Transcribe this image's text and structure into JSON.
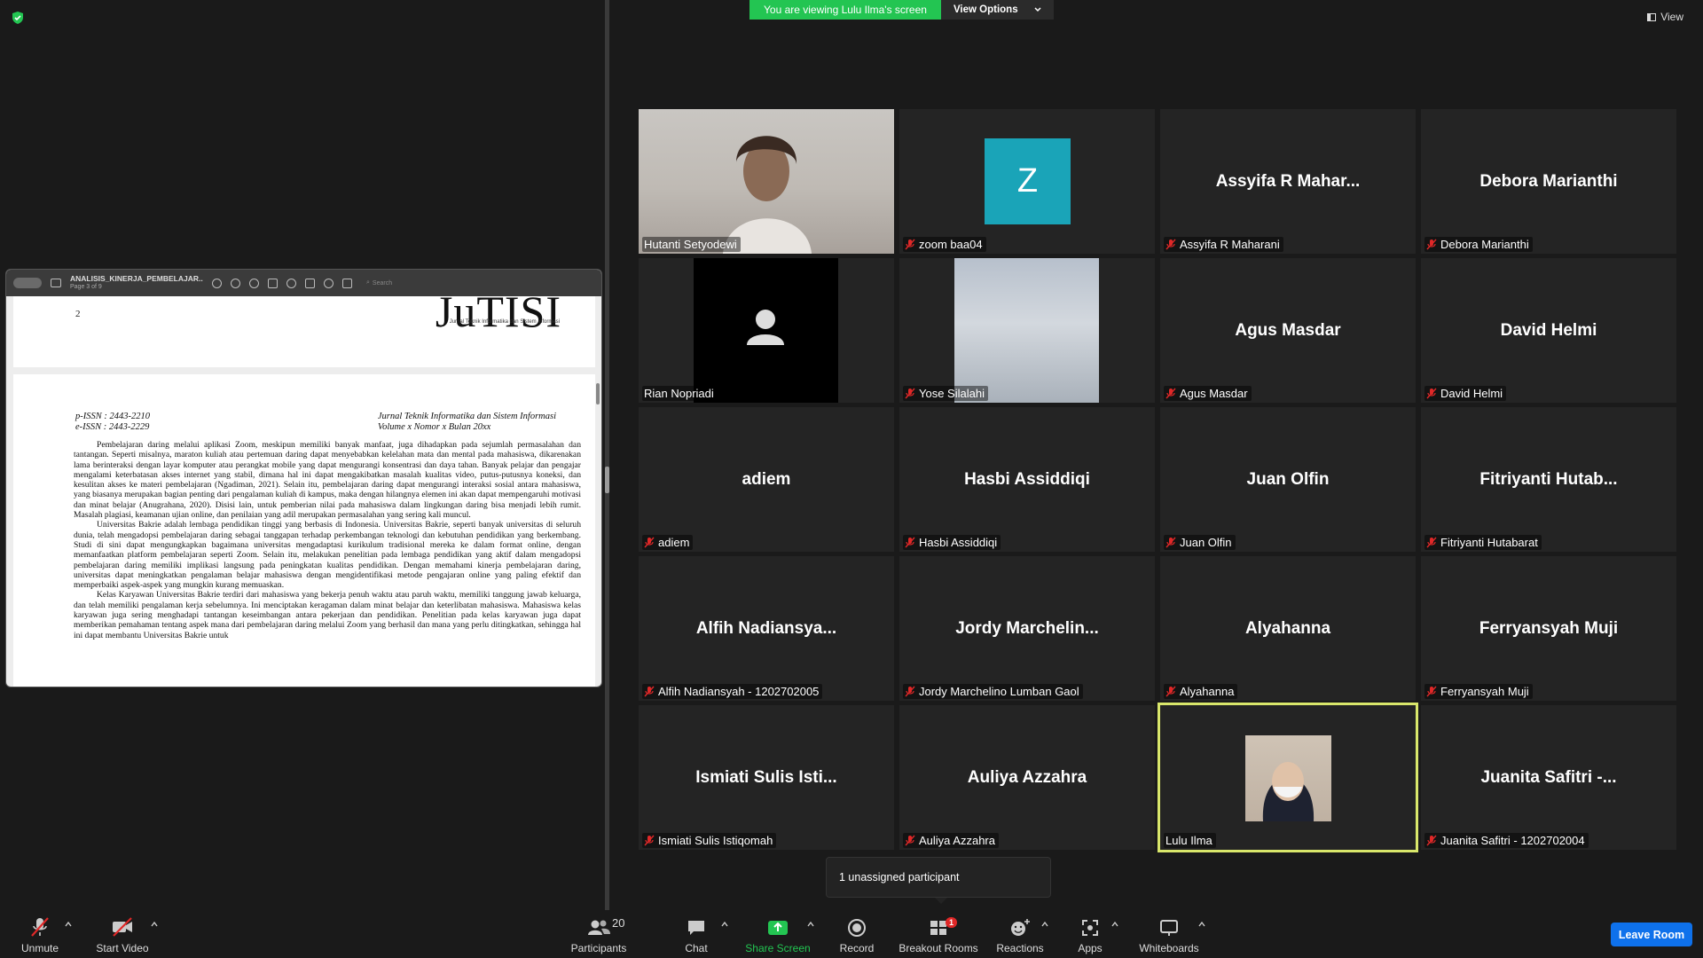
{
  "banner": {
    "viewing_text": "You are viewing Lulu Ilma's screen",
    "view_options_label": "View Options"
  },
  "view_button_label": "View",
  "document": {
    "title": "ANALISIS_KINERJA_PEMBELAJAR...",
    "page_indicator": "Page 3 of 9",
    "search_placeholder": "Search",
    "page_number": "2",
    "logo_text": "JuTISI",
    "logo_subtitle": "Jurnal Teknik Informatika dan Sistem Informasi",
    "p_issn": "p-ISSN : 2443-2210",
    "e_issn": "e-ISSN : 2443-2229",
    "journal_name": "Jurnal Teknik Informatika dan Sistem Informasi",
    "journal_volume": "Volume x Nomor x Bulan 20xx",
    "paragraphs": [
      "Pembelajaran daring melalui aplikasi Zoom, meskipun memiliki banyak manfaat, juga dihadapkan pada sejumlah permasalahan dan tantangan. Seperti misalnya, maraton kuliah atau pertemuan daring dapat menyebabkan kelelahan mata dan mental pada mahasiswa, dikarenakan lama berinteraksi dengan layar komputer atau perangkat mobile yang dapat mengurangi konsentrasi dan daya tahan. Banyak pelajar dan pengajar mengalami keterbatasan akses internet yang stabil, dimana hal ini dapat mengakibatkan masalah kualitas video, putus-putusnya koneksi, dan kesulitan akses ke materi pembelajaran (Ngadiman, 2021). Selain itu, pembelajaran daring dapat mengurangi interaksi sosial antara mahasiswa, yang biasanya merupakan bagian penting dari pengalaman kuliah di kampus, maka dengan hilangnya elemen ini akan dapat mempengaruhi motivasi dan minat belajar (Anugrahana, 2020). Disisi lain, untuk pemberian nilai pada mahasiswa dalam lingkungan daring bisa menjadi lebih rumit. Masalah plagiasi, keamanan ujian online, dan penilaian yang adil merupakan permasalahan yang sering kali muncul.",
      "Universitas Bakrie adalah lembaga pendidikan tinggi yang berbasis di Indonesia. Universitas Bakrie, seperti banyak universitas di seluruh dunia, telah mengadopsi pembelajaran daring sebagai tanggapan terhadap perkembangan teknologi dan kebutuhan pendidikan yang berkembang. Studi di sini dapat mengungkapkan bagaimana universitas mengadaptasi kurikulum tradisional mereka ke dalam format online, dengan memanfaatkan platform pembelajaran seperti Zoom. Selain itu, melakukan penelitian pada lembaga pendidikan yang aktif dalam mengadopsi pembelajaran daring memiliki implikasi langsung pada peningkatan kualitas pendidikan. Dengan memahami kinerja pembelajaran daring, universitas dapat meningkatkan pengalaman belajar mahasiswa dengan mengidentifikasi metode pengajaran online yang paling efektif dan memperbaiki aspek-aspek yang mungkin kurang memuaskan.",
      "Kelas Karyawan Universitas Bakrie terdiri dari mahasiswa yang bekerja penuh waktu atau paruh waktu, memiliki tanggung jawab keluarga, dan telah memiliki pengalaman kerja sebelumnya. Ini menciptakan keragaman dalam minat belajar dan keterlibatan mahasiswa. Mahasiswa kelas karyawan juga sering menghadapi tantangan keseimbangan antara pekerjaan dan pendidikan. Penelitian pada kelas karyawan juga dapat memberikan pemahaman tentang aspek mana dari pembelajaran daring melalui Zoom yang berhasil dan mana yang perlu ditingkatkan, sehingga hal ini dapat membantu Universitas Bakrie untuk"
    ]
  },
  "participants": [
    {
      "name": "Hutanti Setyodewi",
      "center": "",
      "muted": false,
      "kind": "video-hutanti"
    },
    {
      "name": "zoom baa04",
      "center": "",
      "muted": true,
      "kind": "avatar-z",
      "avatar_letter": "Z",
      "avatar_color": "#1aa4b8"
    },
    {
      "name": "Assyifa R Maharani",
      "center": "Assyifa R Mahar...",
      "muted": true,
      "kind": "name"
    },
    {
      "name": "Debora Marianthi",
      "center": "Debora Marianthi",
      "muted": true,
      "kind": "name"
    },
    {
      "name": "Rian Nopriadi",
      "center": "",
      "muted": false,
      "kind": "avatar-rian"
    },
    {
      "name": "Yose Silalahi",
      "center": "",
      "muted": true,
      "kind": "video-yose"
    },
    {
      "name": "Agus Masdar",
      "center": "Agus Masdar",
      "muted": true,
      "kind": "name"
    },
    {
      "name": "David Helmi",
      "center": "David Helmi",
      "muted": true,
      "kind": "name"
    },
    {
      "name": "adiem",
      "center": "adiem",
      "muted": true,
      "kind": "name"
    },
    {
      "name": "Hasbi Assiddiqi",
      "center": "Hasbi Assiddiqi",
      "muted": true,
      "kind": "name"
    },
    {
      "name": "Juan Olfin",
      "center": "Juan Olfin",
      "muted": true,
      "kind": "name"
    },
    {
      "name": "Fitriyanti Hutabarat",
      "center": "Fitriyanti  Hutab...",
      "muted": true,
      "kind": "name"
    },
    {
      "name": "Alfih Nadiansyah - 1202702005",
      "center": "Alfih  Nadiansya...",
      "muted": true,
      "kind": "name"
    },
    {
      "name": "Jordy Marchelino Lumban Gaol",
      "center": "Jordy  Marchelin...",
      "muted": true,
      "kind": "name"
    },
    {
      "name": "Alyahanna",
      "center": "Alyahanna",
      "muted": true,
      "kind": "name"
    },
    {
      "name": "Ferryansyah Muji",
      "center": "Ferryansyah Muji",
      "muted": true,
      "kind": "name"
    },
    {
      "name": "Ismiati Sulis Istiqomah",
      "center": "Ismiati Sulis Isti...",
      "muted": true,
      "kind": "name"
    },
    {
      "name": "Auliya Azzahra",
      "center": "Auliya Azzahra",
      "muted": true,
      "kind": "name"
    },
    {
      "name": "Lulu Ilma",
      "center": "",
      "muted": false,
      "kind": "video-lulu",
      "active": true
    },
    {
      "name": "Juanita Safitri - 1202702004",
      "center": "Juanita Safitri -...",
      "muted": true,
      "kind": "name"
    }
  ],
  "unassigned_text": "1 unassigned participant",
  "toolbar": {
    "unmute": "Unmute",
    "start_video": "Start Video",
    "participants": "Participants",
    "participants_count": "20",
    "chat": "Chat",
    "share_screen": "Share Screen",
    "record": "Record",
    "breakout_rooms": "Breakout Rooms",
    "breakout_badge": "1",
    "reactions": "Reactions",
    "apps": "Apps",
    "whiteboards": "Whiteboards",
    "leave": "Leave Room"
  },
  "colors": {
    "accent_green": "#23c552",
    "active_speaker": "#d9e76b",
    "leave_blue": "#0e71eb",
    "mute_red": "#e02828"
  }
}
